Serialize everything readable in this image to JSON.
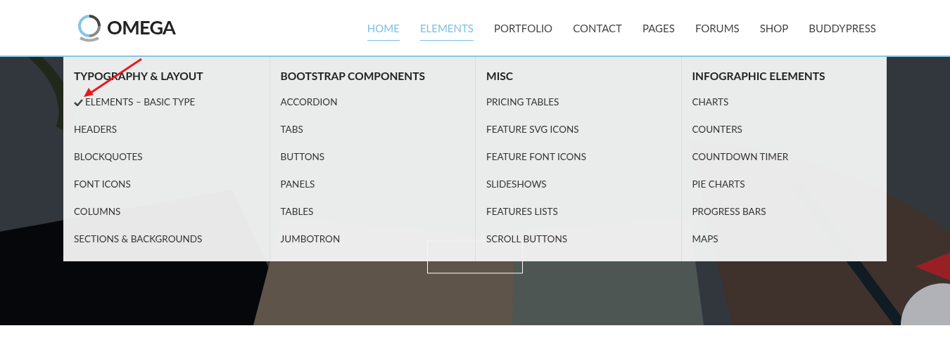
{
  "logo": {
    "text": "OMEGA"
  },
  "nav": [
    {
      "label": "HOME",
      "selected": true
    },
    {
      "label": "ELEMENTS",
      "selected": true
    },
    {
      "label": "PORTFOLIO",
      "selected": false
    },
    {
      "label": "CONTACT",
      "selected": false
    },
    {
      "label": "PAGES",
      "selected": false
    },
    {
      "label": "FORUMS",
      "selected": false
    },
    {
      "label": "SHOP",
      "selected": false
    },
    {
      "label": "BUDDYPRESS",
      "selected": false
    }
  ],
  "mega_menu": [
    {
      "title": "TYPOGRAPHY & LAYOUT",
      "items": [
        {
          "label": "ELEMENTS – BASIC TYPE",
          "checked": true
        },
        {
          "label": "HEADERS",
          "checked": false
        },
        {
          "label": "BLOCKQUOTES",
          "checked": false
        },
        {
          "label": "FONT ICONS",
          "checked": false
        },
        {
          "label": "COLUMNS",
          "checked": false
        },
        {
          "label": "SECTIONS & BACKGROUNDS",
          "checked": false
        }
      ]
    },
    {
      "title": "BOOTSTRAP COMPONENTS",
      "items": [
        {
          "label": "ACCORDION",
          "checked": false
        },
        {
          "label": "TABS",
          "checked": false
        },
        {
          "label": "BUTTONS",
          "checked": false
        },
        {
          "label": "PANELS",
          "checked": false
        },
        {
          "label": "TABLES",
          "checked": false
        },
        {
          "label": "JUMBOTRON",
          "checked": false
        }
      ]
    },
    {
      "title": "MISC",
      "items": [
        {
          "label": "PRICING TABLES",
          "checked": false
        },
        {
          "label": "FEATURE SVG ICONS",
          "checked": false
        },
        {
          "label": "FEATURE FONT ICONS",
          "checked": false
        },
        {
          "label": "SLIDESHOWS",
          "checked": false
        },
        {
          "label": "FEATURES LISTS",
          "checked": false
        },
        {
          "label": "SCROLL BUTTONS",
          "checked": false
        }
      ]
    },
    {
      "title": "INFOGRAPHIC ELEMENTS",
      "items": [
        {
          "label": "CHARTS",
          "checked": false
        },
        {
          "label": "COUNTERS",
          "checked": false
        },
        {
          "label": "COUNTDOWN TIMER",
          "checked": false
        },
        {
          "label": "PIE CHARTS",
          "checked": false
        },
        {
          "label": "PROGRESS BARS",
          "checked": false
        },
        {
          "label": "MAPS",
          "checked": false
        }
      ]
    }
  ]
}
